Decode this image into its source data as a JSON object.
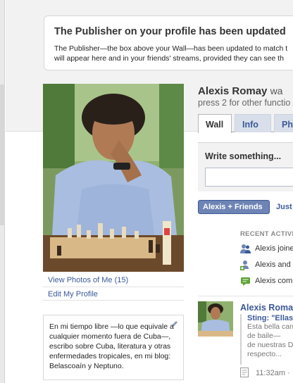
{
  "notice": {
    "title": "The Publisher on your profile has been updated",
    "body_line1": "The Publisher—the box above your Wall—has been updated to match t",
    "body_line2": "will appear here and in your friends' streams, provided they can see th"
  },
  "left_column": {
    "view_photos_link": "View Photos of Me (15)",
    "edit_profile_link": "Edit My Profile",
    "bio": "En mi tiempo libre —lo que equivale a cualquier momento fuera de Cuba—, escribo sobre Cuba, literatura y otras enfermedades tropicales, en mi blog: Belascoaín y Neptuno."
  },
  "header": {
    "name": "Alexis Romay",
    "name_suffix": "wa",
    "status": "press 2 for other functio"
  },
  "tabs": [
    {
      "label": "Wall",
      "active": true
    },
    {
      "label": "Info",
      "active": false
    },
    {
      "label": "Pho",
      "active": false
    }
  ],
  "composer": {
    "label": "Write something..."
  },
  "filters": {
    "active": "Alexis + Friends",
    "other": "Just"
  },
  "recent_activity": {
    "heading": "RECENT ACTIVI",
    "items": [
      {
        "icon": "friends-icon",
        "text": "Alexis joine"
      },
      {
        "icon": "add-friend-icon",
        "text": "Alexis and l"
      },
      {
        "icon": "comment-icon",
        "text": "Alexis comm"
      }
    ]
  },
  "post": {
    "author": "Alexis Roma",
    "headline": "Sting: \"Ellas",
    "lines": [
      "Esta bella can",
      "de baile—",
      "de nuestras D",
      "respecto..."
    ],
    "time": "11:32am ·"
  },
  "colors": {
    "link": "#3b5998",
    "tab_bg": "#d8dfea",
    "pill_bg": "#6d84b4"
  }
}
